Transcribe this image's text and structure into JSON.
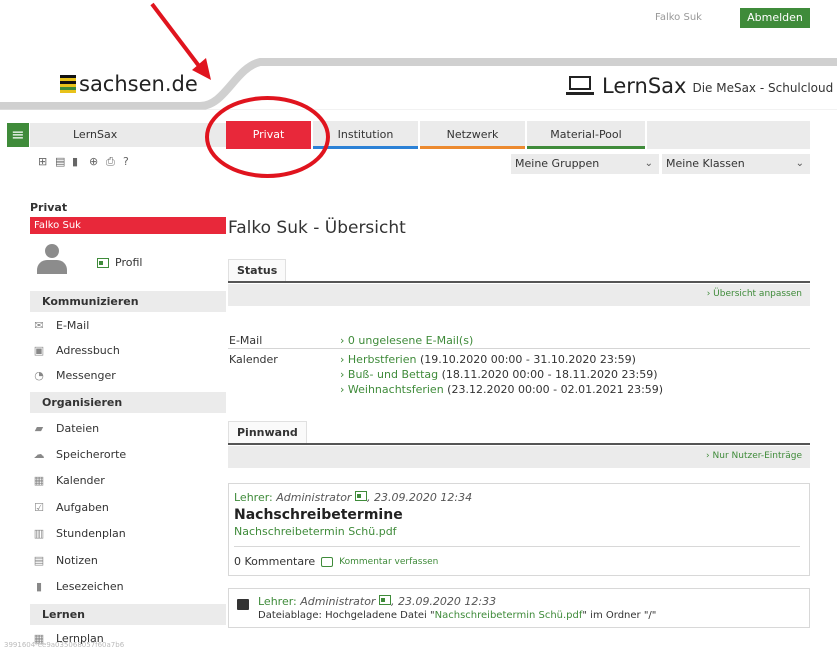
{
  "top": {
    "user_name": "Falko Suk",
    "logout_label": "Abmelden"
  },
  "header": {
    "state_name": "sachsen.de",
    "brand": "LernSax",
    "brand_sub": "Die MeSax - Schulcloud"
  },
  "nav": {
    "app_label": "LernSax",
    "tabs": [
      {
        "label": "Privat",
        "active": true
      },
      {
        "label": "Institution",
        "accent": "#2b81d6"
      },
      {
        "label": "Netzwerk",
        "accent": "#ec8a2f"
      },
      {
        "label": "Material-Pool",
        "accent": "#3f8b3a"
      }
    ],
    "dropdowns": [
      "Meine Gruppen",
      "Meine Klassen"
    ],
    "toolbar_icons": [
      "sitemap-icon",
      "notes-icon",
      "bookmark-icon",
      "expand-icon",
      "print-icon",
      "help-icon"
    ]
  },
  "sidebar": {
    "head": "Privat",
    "user": "Falko Suk",
    "profile": "Profil",
    "sections": [
      {
        "title": "Kommunizieren",
        "items": [
          {
            "label": "E-Mail",
            "icon": "mail-icon"
          },
          {
            "label": "Adressbuch",
            "icon": "addressbook-icon"
          },
          {
            "label": "Messenger",
            "icon": "messenger-icon"
          }
        ]
      },
      {
        "title": "Organisieren",
        "items": [
          {
            "label": "Dateien",
            "icon": "files-icon"
          },
          {
            "label": "Speicherorte",
            "icon": "storage-icon"
          },
          {
            "label": "Kalender",
            "icon": "calendar-icon"
          },
          {
            "label": "Aufgaben",
            "icon": "tasks-icon"
          },
          {
            "label": "Stundenplan",
            "icon": "timetable-icon"
          },
          {
            "label": "Notizen",
            "icon": "notes-icon"
          },
          {
            "label": "Lesezeichen",
            "icon": "bookmark-icon"
          }
        ]
      },
      {
        "title": "Lernen",
        "items": [
          {
            "label": "Lernplan",
            "icon": "learnplan-icon"
          }
        ]
      }
    ]
  },
  "main": {
    "title": "Falko Suk - Übersicht",
    "status": {
      "tab": "Status",
      "link": "Übersicht anpassen",
      "email_label": "E-Mail",
      "email_value": "0 ungelesene E-Mail(s)",
      "calendar_label": "Kalender",
      "events": [
        {
          "name": "Herbstferien",
          "range": "(19.10.2020 00:00 - 31.10.2020 23:59)"
        },
        {
          "name": "Buß- und Bettag",
          "range": "(18.11.2020 00:00 - 18.11.2020 23:59)"
        },
        {
          "name": "Weihnachtsferien",
          "range": "(23.12.2020 00:00 - 02.01.2021 23:59)"
        }
      ]
    },
    "pinnwand": {
      "tab": "Pinnwand",
      "link": "Nur Nutzer-Einträge",
      "post1": {
        "role": "Lehrer:",
        "author": "Administrator",
        "date": ", 23.09.2020 12:34",
        "title": "Nachschreibetermine",
        "file": "Nachschreibetermin Schü.pdf",
        "comments": "0 Kommentare",
        "comment_link": "Kommentar verfassen"
      },
      "post2": {
        "role": "Lehrer:",
        "author": "Administrator",
        "date": ", 23.09.2020 12:33",
        "text_before": "Dateiablage: Hochgeladene Datei \"",
        "file": "Nachschreibetermin Schü.pdf",
        "text_after": "\" im Ordner \"/\""
      }
    }
  },
  "watermark": "3991604-ee9a035068057f60a7b6",
  "colors": {
    "accent_green": "#3f8b3a",
    "active_red": "#e8283a",
    "annotation_red": "#e0141e"
  }
}
